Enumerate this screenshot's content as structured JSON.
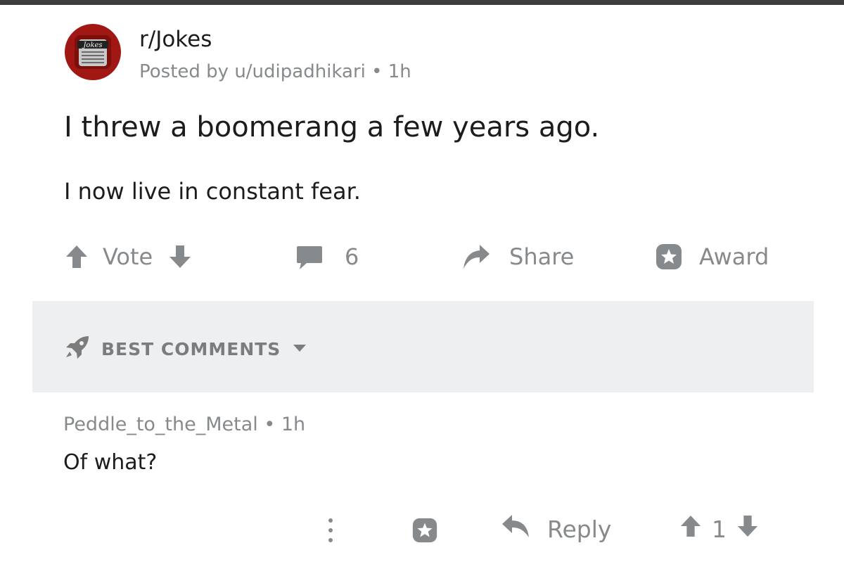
{
  "post": {
    "subreddit": "r/Jokes",
    "avatar_text": "Jokes",
    "meta": "Posted by u/udipadhikari • 1h",
    "title": "I threw a boomerang a few years ago.",
    "body": "I now live in constant fear."
  },
  "actions": {
    "vote_label": "Vote",
    "comment_count": "6",
    "share_label": "Share",
    "award_label": "Award"
  },
  "sort": {
    "label": "BEST COMMENTS"
  },
  "comment": {
    "meta": "Peddle_to_the_Metal • 1h",
    "body": "Of what?",
    "reply_label": "Reply",
    "score": "1"
  },
  "icons": {
    "vote": [
      "upvote-icon",
      "downvote-icon"
    ],
    "comments": "comment-bubble-icon",
    "share": "share-arrow-icon",
    "award": "award-icon",
    "sort": "rocket-icon",
    "more": "more-vertical-icon",
    "reply": "reply-icon"
  },
  "colors": {
    "text": "#1c1c1c",
    "muted": "#878a8c",
    "sort_bg": "#edeff1",
    "avatar_red": "#a01714"
  }
}
